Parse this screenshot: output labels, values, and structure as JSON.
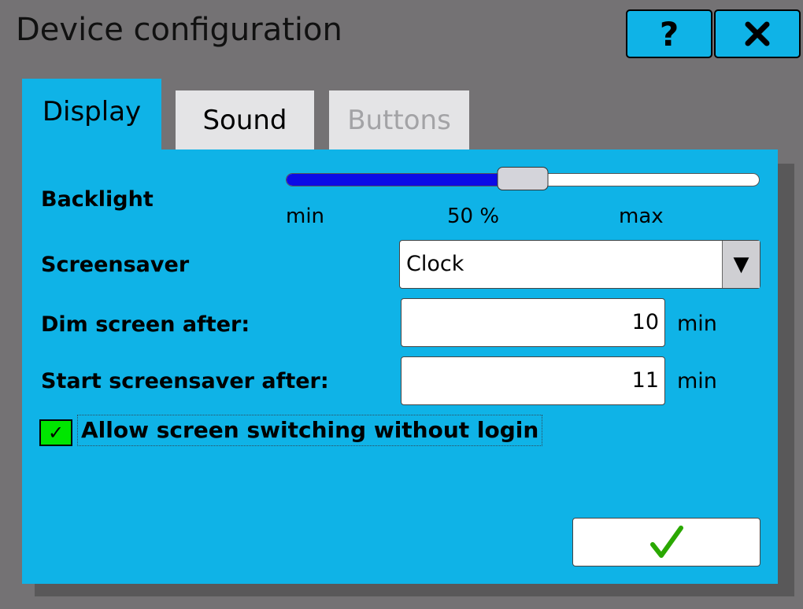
{
  "window": {
    "title": "Device configuration",
    "help_label": "?",
    "close_label": "✕"
  },
  "tabs": [
    {
      "label": "Display",
      "state": "active"
    },
    {
      "label": "Sound",
      "state": "normal"
    },
    {
      "label": "Buttons",
      "state": "disabled"
    }
  ],
  "display": {
    "backlight": {
      "label": "Backlight",
      "min_label": "min",
      "value_label": "50 %",
      "max_label": "max",
      "value_fraction": 0.5
    },
    "screensaver": {
      "label": "Screensaver",
      "selected": "Clock"
    },
    "dim_screen": {
      "label": "Dim screen after:",
      "value": "10",
      "unit": "min"
    },
    "start_screensaver": {
      "label": "Start screensaver after:",
      "value": "11",
      "unit": "min"
    },
    "screen_switching": {
      "label": "Allow screen switching without login",
      "checked": true,
      "check_glyph": "✓"
    }
  },
  "actions": {
    "confirm_icon": "checkmark-icon"
  },
  "colors": {
    "accent": "#0fb3e7",
    "slider_fill": "#0b0be6",
    "checkbox": "#00e600",
    "confirm_check": "#2aa800"
  }
}
